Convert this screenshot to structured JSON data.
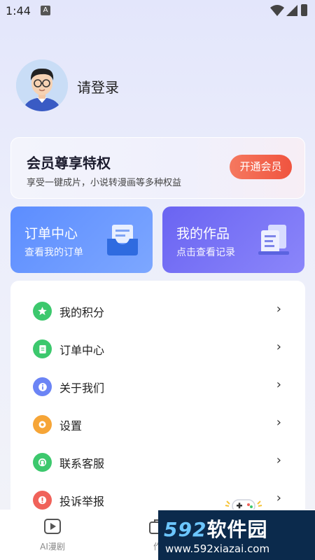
{
  "status_bar": {
    "time": "1:44",
    "notification_icon": "A"
  },
  "profile": {
    "login_label": "请登录",
    "avatar_icon": "user-avatar"
  },
  "vip": {
    "title": "会员尊享特权",
    "subtitle": "享受一键成片，小说转漫画等多种权益",
    "button": "开通会员",
    "accent": "#f0543f"
  },
  "quick_cards": {
    "orders": {
      "title": "订单中心",
      "subtitle": "查看我的订单",
      "icon": "inbox-icon",
      "color": "#6b97ff"
    },
    "works": {
      "title": "我的作品",
      "subtitle": "点击查看记录",
      "icon": "documents-icon",
      "color": "#7772f6"
    }
  },
  "menu": [
    {
      "label": "我的积分",
      "icon": "star-icon",
      "color": "#3cc86d"
    },
    {
      "label": "订单中心",
      "icon": "list-icon",
      "color": "#3cc86d"
    },
    {
      "label": "关于我们",
      "icon": "info-icon",
      "color": "#6b84f5"
    },
    {
      "label": "设置",
      "icon": "gear-icon",
      "color": "#f6a537"
    },
    {
      "label": "联系客服",
      "icon": "headset-icon",
      "color": "#3cc86d"
    },
    {
      "label": "投诉举报",
      "icon": "report-icon",
      "color": "#f0625a"
    }
  ],
  "tabs": [
    {
      "label": "AI漫剧",
      "icon": "play-icon"
    },
    {
      "label": "作",
      "icon": "briefcase-icon"
    }
  ],
  "watermark": {
    "brand_num": "592",
    "brand_text": "软件园",
    "url": "www.592xiazai.com"
  }
}
